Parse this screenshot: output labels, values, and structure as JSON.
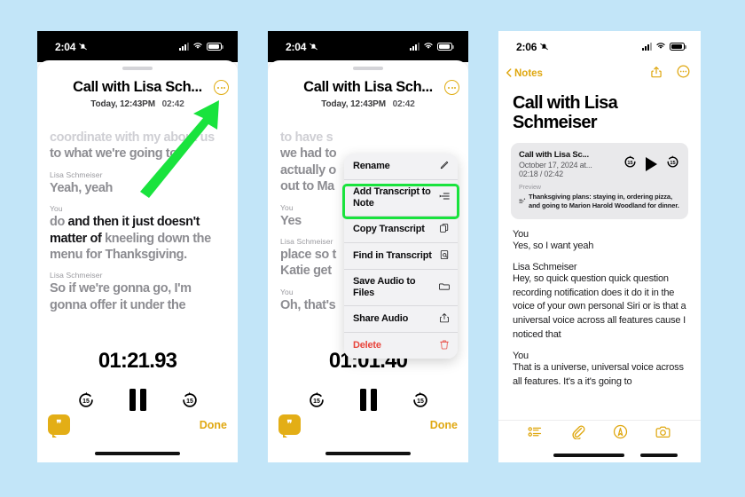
{
  "background_color": "#c2e5f8",
  "accent_yellow": "#e0a812",
  "highlight_green": "#19e33d",
  "phone1": {
    "status": {
      "time": "2:04",
      "mute_icon": "bell-slash-icon",
      "signal_icon": "cellular-signal-icon",
      "wifi_icon": "wifi-icon",
      "battery_icon": "battery-icon"
    },
    "recording": {
      "title": "Call with Lisa Sch...",
      "date": "Today, 12:43PM",
      "duration": "02:42",
      "more_label": "ellipsis-icon"
    },
    "transcript": [
      {
        "speaker": "",
        "faded_top": "coordinate with my about us",
        "text": "to what we're going to",
        "style": "faded"
      },
      {
        "speaker": "Lisa Schmeiser",
        "text": "Yeah, yeah",
        "style": "normal"
      },
      {
        "speaker": "You",
        "text_pre": "do ",
        "text_bold": "and then it just doesn't matter of ",
        "text_post": "kneeling down the menu for Thanksgiving.",
        "style": "mixed"
      },
      {
        "speaker": "Lisa Schmeiser",
        "text": "So if we're gonna go, I'm",
        "text_faded": "gonna offer it under the",
        "style": "normal"
      }
    ],
    "player": {
      "timer": "01:21.93",
      "back_label": "15",
      "forward_label": "15",
      "pause_label": "pause-icon",
      "quote_label": "transcript-toggle-icon",
      "done_label": "Done"
    }
  },
  "phone2": {
    "status": {
      "time": "2:04"
    },
    "recording": {
      "title": "Call with Lisa Sch...",
      "date": "Today, 12:43PM",
      "duration": "02:42"
    },
    "transcript": [
      {
        "speaker": "",
        "text": "to have s",
        "style": "faded"
      },
      {
        "speaker": "",
        "text": "we had to"
      },
      {
        "speaker": "",
        "text": "actually o"
      },
      {
        "speaker": "",
        "text": "out to Ma"
      },
      {
        "speaker": "You",
        "text": "Yes",
        "style": "strong"
      },
      {
        "speaker": "Lisa Schmeiser",
        "text": "place so t"
      },
      {
        "speaker": "",
        "text": "Katie get"
      },
      {
        "speaker": "You",
        "text": "Oh, that's",
        "style": "faded"
      }
    ],
    "menu": {
      "items": [
        {
          "label": "Rename",
          "icon": "pencil-icon",
          "highlighted": false,
          "danger": false
        },
        {
          "label": "Add Transcript to Note",
          "icon": "text-append-icon",
          "highlighted": true,
          "danger": false
        },
        {
          "label": "Copy Transcript",
          "icon": "copy-icon",
          "highlighted": false,
          "danger": false
        },
        {
          "label": "Find in Transcript",
          "icon": "doc-magnifier-icon",
          "highlighted": false,
          "danger": false
        },
        {
          "label": "Save Audio to Files",
          "icon": "folder-icon",
          "highlighted": false,
          "danger": false
        },
        {
          "label": "Share Audio",
          "icon": "share-icon",
          "highlighted": false,
          "danger": false
        },
        {
          "label": "Delete",
          "icon": "trash-icon",
          "highlighted": false,
          "danger": true
        }
      ]
    },
    "player": {
      "timer": "01:01.40",
      "back_label": "15",
      "forward_label": "15",
      "done_label": "Done"
    }
  },
  "phone3": {
    "status": {
      "time": "2:06"
    },
    "nav": {
      "back_label": "Notes",
      "share_icon": "share-icon",
      "more_icon": "ellipsis-icon"
    },
    "note": {
      "title": "Call with Lisa Schmeiser",
      "audio_card": {
        "name": "Call with Lisa Sc...",
        "date": "October 17, 2024 at...",
        "time": "02:18 / 02:42",
        "preview_label": "Preview",
        "summary": "Thanksgiving plans: staying in, ordering pizza, and going to Marion Harold Woodland for dinner.",
        "back_label": "15",
        "forward_label": "15",
        "play_icon": "play-icon"
      },
      "body": [
        {
          "speaker": "You",
          "text": "Yes, so I want yeah"
        },
        {
          "speaker": "Lisa Schmeiser",
          "text": "Hey, so quick question quick question recording notification does it do it in the voice of your own personal Siri or is that a universal voice across all features cause I noticed that"
        },
        {
          "speaker": "You",
          "text": "That is a universe, universal voice across all features. It's a it's going to"
        }
      ]
    },
    "toolbar": [
      {
        "icon": "checklist-icon"
      },
      {
        "icon": "paperclip-icon"
      },
      {
        "icon": "markup-pen-icon"
      },
      {
        "icon": "camera-icon"
      }
    ]
  },
  "annotation": {
    "arrow_color": "#19e33d",
    "arrow_label": "green-pointer-arrow"
  }
}
